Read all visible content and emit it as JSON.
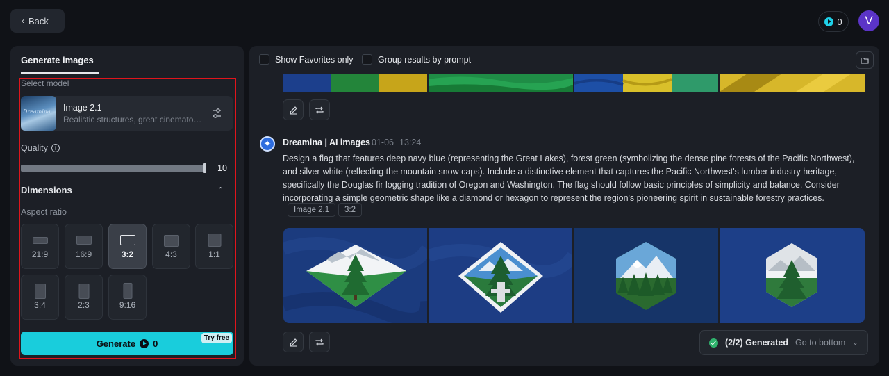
{
  "header": {
    "back_label": "Back",
    "credits": "0",
    "avatar_initial": "V"
  },
  "left_panel": {
    "tab_label": "Generate images",
    "select_model_label": "Select model",
    "model": {
      "name": "Image 2.1",
      "description": "Realistic structures, great cinematography",
      "thumb_text": "Dreamina"
    },
    "quality_label": "Quality",
    "quality_value": "10",
    "dimensions_label": "Dimensions",
    "aspect_ratio_label": "Aspect ratio",
    "ratios": [
      "21:9",
      "16:9",
      "3:2",
      "4:3",
      "1:1",
      "3:4",
      "2:3",
      "9:16"
    ],
    "selected_ratio": "3:2",
    "generate_label": "Generate",
    "generate_cost": "0",
    "try_free_label": "Try free"
  },
  "right_panel": {
    "show_favorites_label": "Show Favorites only",
    "group_results_label": "Group results by prompt",
    "message": {
      "author": "Dreamina | AI images",
      "date": "01-06",
      "time": "13:24",
      "prompt": "Design a flag that features deep navy blue (representing the Great Lakes), forest green (symbolizing the dense pine forests of the Pacific Northwest), and silver-white (reflecting the mountain snow caps). Include a distinctive element that captures the Pacific Northwest's lumber industry heritage, specifically the Douglas fir logging tradition of Oregon and Washington. The flag should follow basic principles of simplicity and balance. Consider incorporating a simple geometric shape like a diamond or hexagon to represent the region's pioneering spirit in sustainable forestry practices.",
      "tags": [
        "Image 2.1",
        "3:2"
      ]
    },
    "status": {
      "generated_label": "(2/2) Generated",
      "goto_label": "Go to bottom"
    }
  },
  "colors": {
    "accent": "#19cddc",
    "navy": "#1a3a7a",
    "forest_green": "#2f7a3c",
    "avatar": "#5b34c7",
    "error_outline": "#e0151c"
  }
}
